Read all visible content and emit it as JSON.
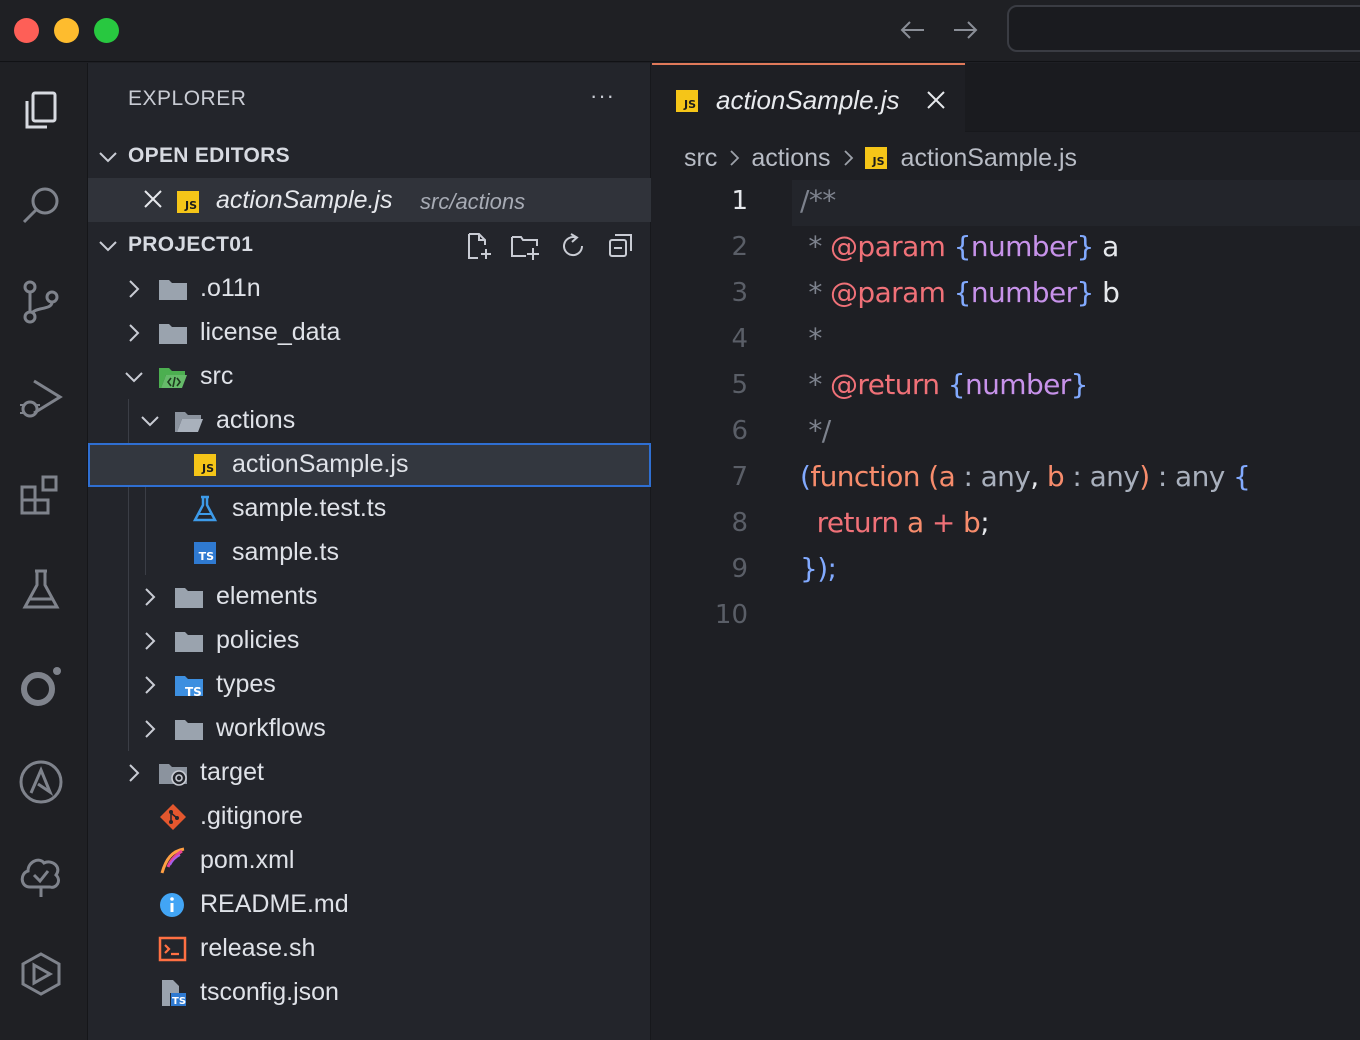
{
  "explorer": {
    "title": "EXPLORER",
    "more": "···",
    "open_editors_label": "OPEN EDITORS",
    "open_editor": {
      "name": "actionSample.js",
      "path": "src/actions",
      "icon": "JS"
    },
    "project_label": "PROJECT01",
    "tree": [
      {
        "name": ".o11n",
        "icon": "folder"
      },
      {
        "name": "license_data",
        "icon": "folder"
      },
      {
        "name": "src",
        "icon": "folder-src-open"
      },
      {
        "name": "actions",
        "icon": "folder-open"
      },
      {
        "name": "actionSample.js",
        "icon": "JS"
      },
      {
        "name": "sample.test.ts",
        "icon": "flask"
      },
      {
        "name": "sample.ts",
        "icon": "TS"
      },
      {
        "name": "elements",
        "icon": "folder"
      },
      {
        "name": "policies",
        "icon": "folder"
      },
      {
        "name": "types",
        "icon": "folder-types"
      },
      {
        "name": "workflows",
        "icon": "folder"
      },
      {
        "name": "target",
        "icon": "folder-target"
      },
      {
        "name": ".gitignore",
        "icon": "git"
      },
      {
        "name": "pom.xml",
        "icon": "feather"
      },
      {
        "name": "README.md",
        "icon": "info"
      },
      {
        "name": "release.sh",
        "icon": "terminal"
      },
      {
        "name": "tsconfig.json",
        "icon": "tsconfig"
      }
    ]
  },
  "icons": {
    "js": "JS",
    "ts": "TS"
  },
  "editor": {
    "tab_label": "actionSample.js",
    "breadcrumb": [
      "src",
      "actions",
      "actionSample.js"
    ],
    "line_numbers": [
      "1",
      "2",
      "3",
      "4",
      "5",
      "6",
      "7",
      "8",
      "9",
      "10"
    ],
    "tokens": {
      "l1_open": "/**",
      "star": "*",
      "param": "@param",
      "return": "@return",
      "type_open": "{",
      "type_name": "number",
      "type_close": "}",
      "a": "a",
      "b": "b",
      "close": "*/",
      "lparen": "(",
      "function": "function",
      "colon": ":",
      "any": "any",
      "comma": ",",
      "rparen": ")",
      "lbrace": "{",
      "return_kw": "return",
      "plus": "+",
      "semi": ";",
      "end": "});"
    }
  },
  "colors": {
    "accent": "#e0795a",
    "selection_border": "#2f6fd2",
    "js_icon": "#f5c518",
    "ts_icon": "#2f7ad1"
  }
}
